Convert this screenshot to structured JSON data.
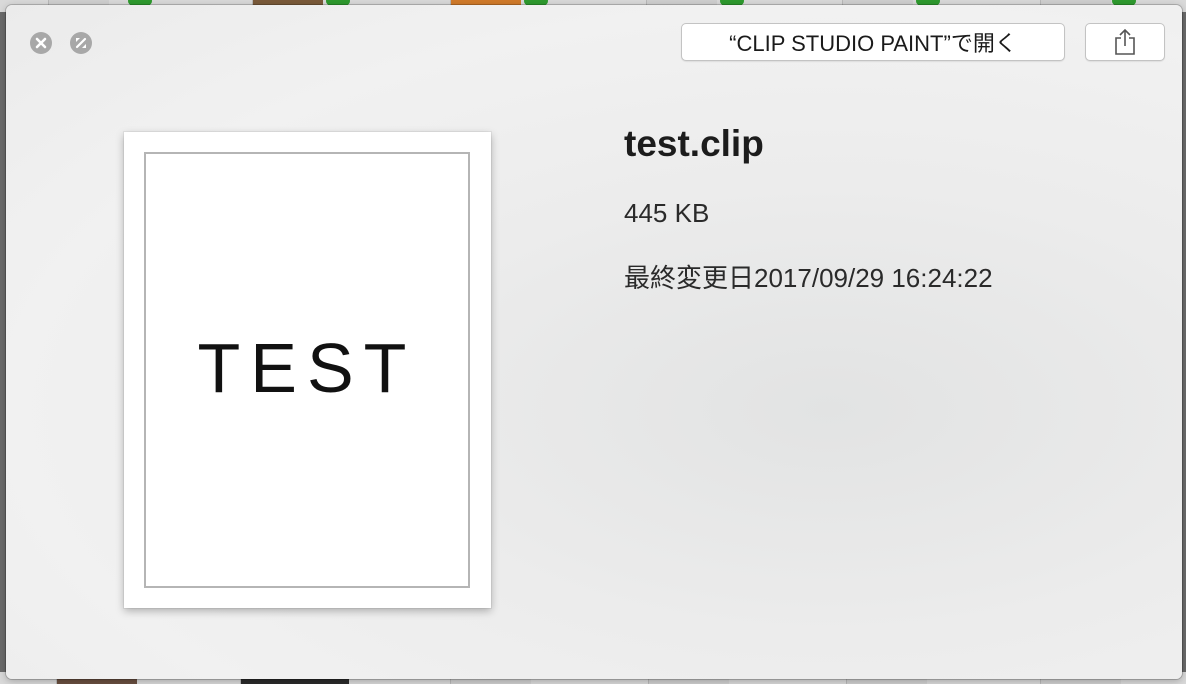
{
  "window": {
    "close_icon": "close-icon",
    "fullscreen_icon": "fullscreen-icon"
  },
  "toolbar": {
    "open_with_label": "“CLIP STUDIO PAINT”で開く",
    "share_icon": "share-icon"
  },
  "preview": {
    "thumbnail_text": "TEST"
  },
  "file": {
    "name": "test.clip",
    "size": "445 KB",
    "modified": "最終変更日2017/09/29 16:24:22"
  },
  "colors": {
    "window_button": "#a8a8a8",
    "background_badge": "#2e9a2e"
  }
}
